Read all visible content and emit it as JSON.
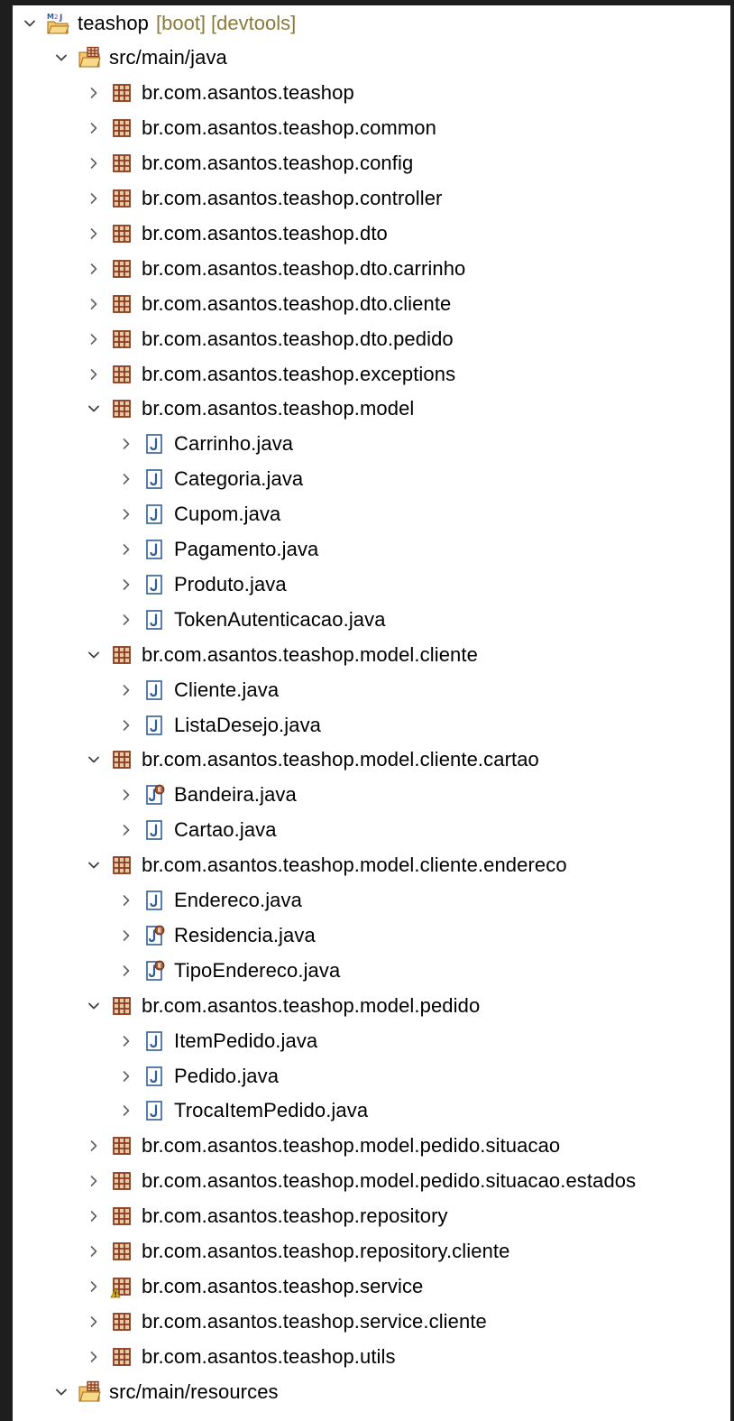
{
  "colors": {
    "background": "#1e1e1e",
    "panel": "#ffffff",
    "text": "#000000",
    "decoration": "#8a7a3a",
    "package_icon": "#8b3b1f",
    "package_fill": "#e8c9a6",
    "java_icon": "#2f5d9a",
    "warning": "#e6b400",
    "chevron": "#404040"
  },
  "project": {
    "label": "teashop",
    "decorations": [
      "[boot]",
      "[devtools]"
    ],
    "icon": "maven-java-project-icon",
    "expanded": true
  },
  "rows": [
    {
      "level": 1,
      "label": "src/main/java",
      "icon": "source-folder-icon",
      "expanded": true
    },
    {
      "level": 2,
      "label": "br.com.asantos.teashop",
      "icon": "package-icon",
      "expanded": false
    },
    {
      "level": 2,
      "label": "br.com.asantos.teashop.common",
      "icon": "package-icon",
      "expanded": false
    },
    {
      "level": 2,
      "label": "br.com.asantos.teashop.config",
      "icon": "package-icon",
      "expanded": false
    },
    {
      "level": 2,
      "label": "br.com.asantos.teashop.controller",
      "icon": "package-icon",
      "expanded": false
    },
    {
      "level": 2,
      "label": "br.com.asantos.teashop.dto",
      "icon": "package-icon",
      "expanded": false
    },
    {
      "level": 2,
      "label": "br.com.asantos.teashop.dto.carrinho",
      "icon": "package-icon",
      "expanded": false
    },
    {
      "level": 2,
      "label": "br.com.asantos.teashop.dto.cliente",
      "icon": "package-icon",
      "expanded": false
    },
    {
      "level": 2,
      "label": "br.com.asantos.teashop.dto.pedido",
      "icon": "package-icon",
      "expanded": false
    },
    {
      "level": 2,
      "label": "br.com.asantos.teashop.exceptions",
      "icon": "package-icon",
      "expanded": false
    },
    {
      "level": 2,
      "label": "br.com.asantos.teashop.model",
      "icon": "package-icon",
      "expanded": true
    },
    {
      "level": 3,
      "label": "Carrinho.java",
      "icon": "java-file-icon",
      "expanded": false
    },
    {
      "level": 3,
      "label": "Categoria.java",
      "icon": "java-file-icon",
      "expanded": false
    },
    {
      "level": 3,
      "label": "Cupom.java",
      "icon": "java-file-icon",
      "expanded": false
    },
    {
      "level": 3,
      "label": "Pagamento.java",
      "icon": "java-file-icon",
      "expanded": false
    },
    {
      "level": 3,
      "label": "Produto.java",
      "icon": "java-file-icon",
      "expanded": false
    },
    {
      "level": 3,
      "label": "TokenAutenticacao.java",
      "icon": "java-file-icon",
      "expanded": false
    },
    {
      "level": 2,
      "label": "br.com.asantos.teashop.model.cliente",
      "icon": "package-icon",
      "expanded": true
    },
    {
      "level": 3,
      "label": "Cliente.java",
      "icon": "java-file-icon",
      "expanded": false
    },
    {
      "level": 3,
      "label": "ListaDesejo.java",
      "icon": "java-file-icon",
      "expanded": false
    },
    {
      "level": 2,
      "label": "br.com.asantos.teashop.model.cliente.cartao",
      "icon": "package-icon",
      "expanded": true
    },
    {
      "level": 3,
      "label": "Bandeira.java",
      "icon": "java-enum-file-icon",
      "expanded": false
    },
    {
      "level": 3,
      "label": "Cartao.java",
      "icon": "java-file-icon",
      "expanded": false
    },
    {
      "level": 2,
      "label": "br.com.asantos.teashop.model.cliente.endereco",
      "icon": "package-icon",
      "expanded": true
    },
    {
      "level": 3,
      "label": "Endereco.java",
      "icon": "java-file-icon",
      "expanded": false
    },
    {
      "level": 3,
      "label": "Residencia.java",
      "icon": "java-enum-file-icon",
      "expanded": false
    },
    {
      "level": 3,
      "label": "TipoEndereco.java",
      "icon": "java-enum-file-icon",
      "expanded": false
    },
    {
      "level": 2,
      "label": "br.com.asantos.teashop.model.pedido",
      "icon": "package-icon",
      "expanded": true
    },
    {
      "level": 3,
      "label": "ItemPedido.java",
      "icon": "java-file-icon",
      "expanded": false
    },
    {
      "level": 3,
      "label": "Pedido.java",
      "icon": "java-file-icon",
      "expanded": false
    },
    {
      "level": 3,
      "label": "TrocaItemPedido.java",
      "icon": "java-file-icon",
      "expanded": false
    },
    {
      "level": 2,
      "label": "br.com.asantos.teashop.model.pedido.situacao",
      "icon": "package-icon",
      "expanded": false
    },
    {
      "level": 2,
      "label": "br.com.asantos.teashop.model.pedido.situacao.estados",
      "icon": "package-icon",
      "expanded": false
    },
    {
      "level": 2,
      "label": "br.com.asantos.teashop.repository",
      "icon": "package-icon",
      "expanded": false
    },
    {
      "level": 2,
      "label": "br.com.asantos.teashop.repository.cliente",
      "icon": "package-icon",
      "expanded": false
    },
    {
      "level": 2,
      "label": "br.com.asantos.teashop.service",
      "icon": "package-warning-icon",
      "expanded": false
    },
    {
      "level": 2,
      "label": "br.com.asantos.teashop.service.cliente",
      "icon": "package-icon",
      "expanded": false
    },
    {
      "level": 2,
      "label": "br.com.asantos.teashop.utils",
      "icon": "package-icon",
      "expanded": false
    },
    {
      "level": 1,
      "label": "src/main/resources",
      "icon": "source-folder-icon",
      "expanded": true
    }
  ]
}
